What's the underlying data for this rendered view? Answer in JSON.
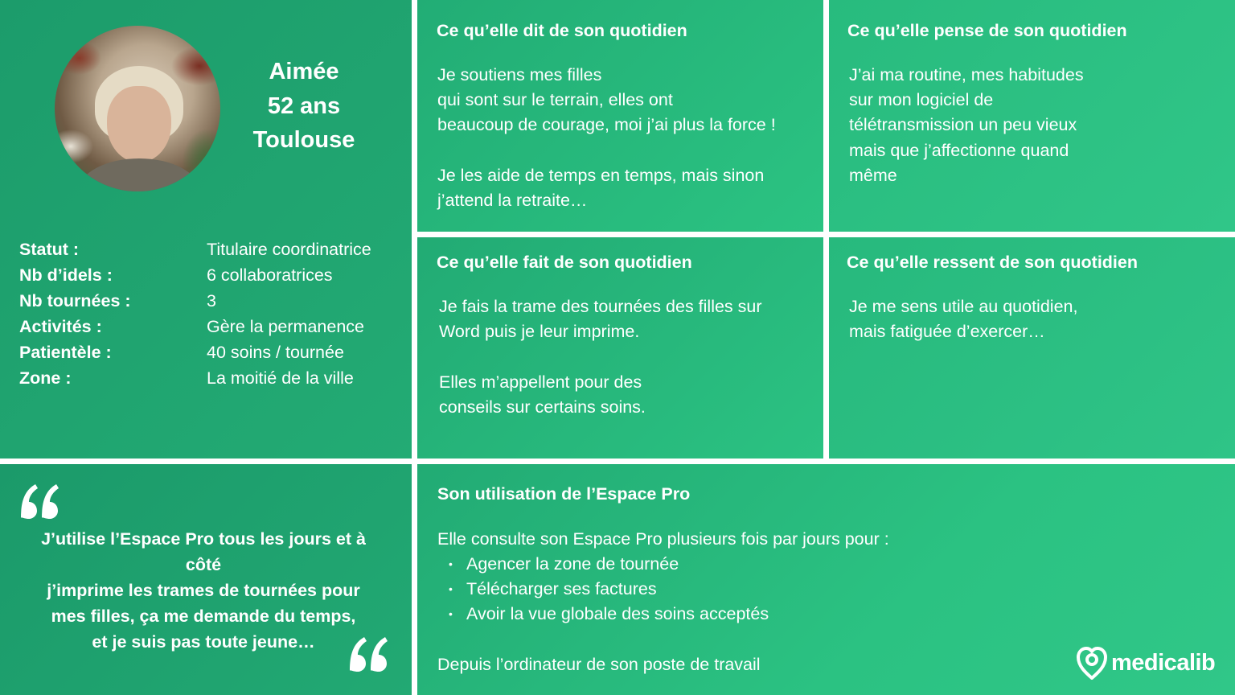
{
  "profile": {
    "name": "Aimée",
    "age": "52 ans",
    "city": "Toulouse",
    "details": [
      {
        "key": "Statut :",
        "value": "Titulaire coordinatrice"
      },
      {
        "key": "Nb d’idels :",
        "value": "6 collaboratrices"
      },
      {
        "key": "Nb tournées :",
        "value": "3"
      },
      {
        "key": "Activités :",
        "value": "Gère la permanence"
      },
      {
        "key": "Patientèle :",
        "value": "40 soins / tournée"
      },
      {
        "key": "Zone :",
        "value": "La moitié de la ville"
      }
    ]
  },
  "says": {
    "title": "Ce qu’elle dit de son quotidien",
    "lines": [
      "Je soutiens mes filles",
      "qui sont sur le terrain, elles ont",
      "beaucoup de courage, moi j’ai plus la force !",
      "",
      "Je les aide de temps en temps, mais sinon",
      "j’attend la retraite…"
    ]
  },
  "thinks": {
    "title": "Ce qu’elle pense de son quotidien",
    "lines": [
      "J’ai ma routine, mes habitudes",
      "sur mon logiciel de",
      "télétransmission un peu vieux",
      "mais que j’affectionne quand",
      "même"
    ]
  },
  "does": {
    "title": "Ce qu’elle fait de son quotidien",
    "lines": [
      "Je fais la trame des tournées des filles sur",
      "Word puis je leur imprime.",
      "",
      "Elles m’appellent pour des",
      "conseils sur certains soins."
    ]
  },
  "feels": {
    "title": "Ce qu’elle ressent de son quotidien",
    "lines": [
      "Je me sens utile au quotidien,",
      "mais fatiguée d’exercer…"
    ]
  },
  "quote": {
    "lines": [
      "J’utilise l’Espace Pro tous les jours et à",
      "côté",
      "j’imprime les trames de tournées pour",
      "mes filles, ça me demande du temps,",
      "et je suis pas toute jeune…"
    ]
  },
  "usage": {
    "title": "Son utilisation de l’Espace Pro",
    "intro": "Elle consulte son Espace Pro plusieurs fois par jours pour :",
    "items": [
      "Agencer la zone de tournée",
      "Télécharger ses factures",
      "Avoir la vue globale des soins acceptés"
    ],
    "footer": "Depuis l’ordinateur de son poste de travail"
  },
  "brand": {
    "name": "medicalib",
    "icon": "heart-location-icon",
    "color": "#ffffff"
  },
  "colors": {
    "green_dark": "#1c9c6b",
    "green_light": "#2dc584",
    "separator": "#ffffff"
  }
}
